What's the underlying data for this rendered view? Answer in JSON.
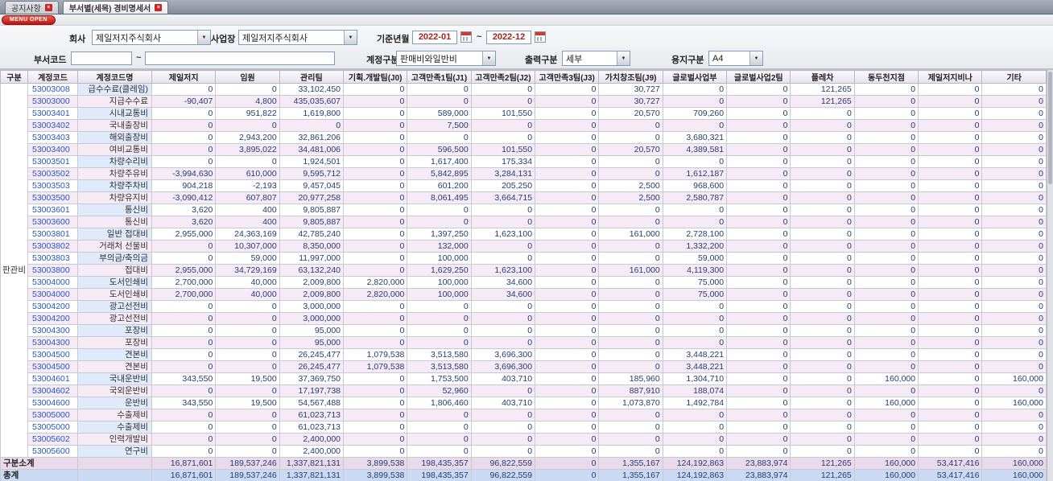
{
  "tabs": [
    {
      "label": "공지사항"
    },
    {
      "label": "부서별(세목) 경비명세서"
    }
  ],
  "menu_open_label": "MENU OPEN",
  "filters": {
    "company_label": "회사",
    "company_value": "제일저지주식회사",
    "workplace_label": "사업장",
    "workplace_value": "제일저지주식회사",
    "period_label": "기준년월",
    "period_from": "2022-01",
    "period_to": "2022-12",
    "tilde": "~",
    "dept_code_label": "부서코드",
    "dept_code_from": "",
    "dept_code_to": "",
    "account_type_label": "계정구분",
    "account_type_value": "판매비와일반비",
    "output_type_label": "출력구분",
    "output_type_value": "세부",
    "paper_type_label": "용지구분",
    "paper_type_value": "A4"
  },
  "table": {
    "headers": [
      "구분",
      "계정코드",
      "계정코드명",
      "제일저지",
      "임원",
      "관리팀",
      "기획.개발팀(J0)",
      "고객만족1팀(J1)",
      "고객만족2팀(J2)",
      "고객만족3팀(J3)",
      "가치창조팀(J9)",
      "글로벌사업부",
      "글로벌사업2팀",
      "플레차",
      "동두천지점",
      "제일저지비나",
      "기타"
    ],
    "group_label": "판관비",
    "rows": [
      {
        "code": "53003008",
        "name": "급수수료(클레임)",
        "values": [
          "0",
          "0",
          "33,102,450",
          "0",
          "0",
          "0",
          "0",
          "30,727",
          "0",
          "0",
          "121,265",
          "0",
          "0",
          "0"
        ]
      },
      {
        "code": "53003000",
        "name": "지급수수료",
        "values": [
          "-90,407",
          "4,800",
          "435,035,607",
          "0",
          "0",
          "0",
          "0",
          "30,727",
          "0",
          "0",
          "121,265",
          "0",
          "0",
          "0"
        ]
      },
      {
        "code": "53003401",
        "name": "시내교통비",
        "values": [
          "0",
          "951,822",
          "1,619,800",
          "0",
          "589,000",
          "101,550",
          "0",
          "20,570",
          "709,260",
          "0",
          "0",
          "0",
          "0",
          "0"
        ]
      },
      {
        "code": "53003402",
        "name": "국내출장비",
        "values": [
          "0",
          "0",
          "0",
          "0",
          "7,500",
          "0",
          "0",
          "0",
          "0",
          "0",
          "0",
          "0",
          "0",
          "0"
        ]
      },
      {
        "code": "53003403",
        "name": "해외출장비",
        "values": [
          "0",
          "2,943,200",
          "32,861,206",
          "0",
          "0",
          "0",
          "0",
          "0",
          "3,680,321",
          "0",
          "0",
          "0",
          "0",
          "0"
        ]
      },
      {
        "code": "53003400",
        "name": "여비교통비",
        "values": [
          "0",
          "3,895,022",
          "34,481,006",
          "0",
          "596,500",
          "101,550",
          "0",
          "20,570",
          "4,389,581",
          "0",
          "0",
          "0",
          "0",
          "0"
        ]
      },
      {
        "code": "53003501",
        "name": "차량수리비",
        "values": [
          "0",
          "0",
          "1,924,501",
          "0",
          "1,617,400",
          "175,334",
          "0",
          "0",
          "0",
          "0",
          "0",
          "0",
          "0",
          "0"
        ]
      },
      {
        "code": "53003502",
        "name": "차량주유비",
        "values": [
          "-3,994,630",
          "610,000",
          "9,595,712",
          "0",
          "5,842,895",
          "3,284,131",
          "0",
          "0",
          "1,612,187",
          "0",
          "0",
          "0",
          "0",
          "0"
        ]
      },
      {
        "code": "53003503",
        "name": "차량주차비",
        "values": [
          "904,218",
          "-2,193",
          "9,457,045",
          "0",
          "601,200",
          "205,250",
          "0",
          "2,500",
          "968,600",
          "0",
          "0",
          "0",
          "0",
          "0"
        ]
      },
      {
        "code": "53003500",
        "name": "차량유지비",
        "values": [
          "-3,090,412",
          "607,807",
          "20,977,258",
          "0",
          "8,061,495",
          "3,664,715",
          "0",
          "2,500",
          "2,580,787",
          "0",
          "0",
          "0",
          "0",
          "0"
        ]
      },
      {
        "code": "53003601",
        "name": "통신비",
        "values": [
          "3,620",
          "400",
          "9,805,887",
          "0",
          "0",
          "0",
          "0",
          "0",
          "0",
          "0",
          "0",
          "0",
          "0",
          "0"
        ]
      },
      {
        "code": "53003600",
        "name": "통신비",
        "values": [
          "3,620",
          "400",
          "9,805,887",
          "0",
          "0",
          "0",
          "0",
          "0",
          "0",
          "0",
          "0",
          "0",
          "0",
          "0"
        ]
      },
      {
        "code": "53003801",
        "name": "일반 접대비",
        "values": [
          "2,955,000",
          "24,363,169",
          "42,785,240",
          "0",
          "1,397,250",
          "1,623,100",
          "0",
          "161,000",
          "2,728,100",
          "0",
          "0",
          "0",
          "0",
          "0"
        ]
      },
      {
        "code": "53003802",
        "name": "거래처 선물비",
        "values": [
          "0",
          "10,307,000",
          "8,350,000",
          "0",
          "132,000",
          "0",
          "0",
          "0",
          "1,332,200",
          "0",
          "0",
          "0",
          "0",
          "0"
        ]
      },
      {
        "code": "53003803",
        "name": "부의금/축의금",
        "values": [
          "0",
          "59,000",
          "11,997,000",
          "0",
          "100,000",
          "0",
          "0",
          "0",
          "59,000",
          "0",
          "0",
          "0",
          "0",
          "0"
        ]
      },
      {
        "code": "53003800",
        "name": "접대비",
        "values": [
          "2,955,000",
          "34,729,169",
          "63,132,240",
          "0",
          "1,629,250",
          "1,623,100",
          "0",
          "161,000",
          "4,119,300",
          "0",
          "0",
          "0",
          "0",
          "0"
        ]
      },
      {
        "code": "53004000",
        "name": "도서인쇄비",
        "values": [
          "2,700,000",
          "40,000",
          "2,009,800",
          "2,820,000",
          "100,000",
          "34,600",
          "0",
          "0",
          "75,000",
          "0",
          "0",
          "0",
          "0",
          "0"
        ]
      },
      {
        "code": "53004000",
        "name": "도서인쇄비",
        "values": [
          "2,700,000",
          "40,000",
          "2,009,800",
          "2,820,000",
          "100,000",
          "34,600",
          "0",
          "0",
          "75,000",
          "0",
          "0",
          "0",
          "0",
          "0"
        ]
      },
      {
        "code": "53004200",
        "name": "광고선전비",
        "values": [
          "0",
          "0",
          "3,000,000",
          "0",
          "0",
          "0",
          "0",
          "0",
          "0",
          "0",
          "0",
          "0",
          "0",
          "0"
        ]
      },
      {
        "code": "53004200",
        "name": "광고선전비",
        "values": [
          "0",
          "0",
          "3,000,000",
          "0",
          "0",
          "0",
          "0",
          "0",
          "0",
          "0",
          "0",
          "0",
          "0",
          "0"
        ]
      },
      {
        "code": "53004300",
        "name": "포장비",
        "values": [
          "0",
          "0",
          "95,000",
          "0",
          "0",
          "0",
          "0",
          "0",
          "0",
          "0",
          "0",
          "0",
          "0",
          "0"
        ]
      },
      {
        "code": "53004300",
        "name": "포장비",
        "values": [
          "0",
          "0",
          "95,000",
          "0",
          "0",
          "0",
          "0",
          "0",
          "0",
          "0",
          "0",
          "0",
          "0",
          "0"
        ]
      },
      {
        "code": "53004500",
        "name": "견본비",
        "values": [
          "0",
          "0",
          "26,245,477",
          "1,079,538",
          "3,513,580",
          "3,696,300",
          "0",
          "0",
          "3,448,221",
          "0",
          "0",
          "0",
          "0",
          "0"
        ]
      },
      {
        "code": "53004500",
        "name": "견본비",
        "values": [
          "0",
          "0",
          "26,245,477",
          "1,079,538",
          "3,513,580",
          "3,696,300",
          "0",
          "0",
          "3,448,221",
          "0",
          "0",
          "0",
          "0",
          "0"
        ]
      },
      {
        "code": "53004601",
        "name": "국내운반비",
        "values": [
          "343,550",
          "19,500",
          "37,369,750",
          "0",
          "1,753,500",
          "403,710",
          "0",
          "185,960",
          "1,304,710",
          "0",
          "0",
          "160,000",
          "0",
          "160,000"
        ]
      },
      {
        "code": "53004602",
        "name": "국외운반비",
        "values": [
          "0",
          "0",
          "17,197,738",
          "0",
          "52,960",
          "0",
          "0",
          "887,910",
          "188,074",
          "0",
          "0",
          "0",
          "0",
          "0"
        ]
      },
      {
        "code": "53004600",
        "name": "운반비",
        "values": [
          "343,550",
          "19,500",
          "54,567,488",
          "0",
          "1,806,460",
          "403,710",
          "0",
          "1,073,870",
          "1,492,784",
          "0",
          "0",
          "160,000",
          "0",
          "160,000"
        ]
      },
      {
        "code": "53005000",
        "name": "수출제비",
        "values": [
          "0",
          "0",
          "61,023,713",
          "0",
          "0",
          "0",
          "0",
          "0",
          "0",
          "0",
          "0",
          "0",
          "0",
          "0"
        ]
      },
      {
        "code": "53005000",
        "name": "수출제비",
        "values": [
          "0",
          "0",
          "61,023,713",
          "0",
          "0",
          "0",
          "0",
          "0",
          "0",
          "0",
          "0",
          "0",
          "0",
          "0"
        ]
      },
      {
        "code": "53005602",
        "name": "인력개발비",
        "values": [
          "0",
          "0",
          "2,400,000",
          "0",
          "0",
          "0",
          "0",
          "0",
          "0",
          "0",
          "0",
          "0",
          "0",
          "0"
        ]
      },
      {
        "code": "53005600",
        "name": "연구비",
        "values": [
          "0",
          "0",
          "2,400,000",
          "0",
          "0",
          "0",
          "0",
          "0",
          "0",
          "0",
          "0",
          "0",
          "0",
          "0"
        ]
      }
    ],
    "subtotal": {
      "label": "구분소계",
      "values": [
        "16,871,601",
        "189,537,246",
        "1,337,821,131",
        "3,899,538",
        "198,435,357",
        "96,822,559",
        "0",
        "1,355,167",
        "124,192,863",
        "23,883,974",
        "121,265",
        "160,000",
        "53,417,416",
        "160,000"
      ]
    },
    "total": {
      "label": "총계",
      "values": [
        "16,871,601",
        "189,537,246",
        "1,337,821,131",
        "3,899,538",
        "198,435,357",
        "96,822,559",
        "0",
        "1,355,167",
        "124,192,863",
        "23,883,974",
        "121,265",
        "160,000",
        "53,417,416",
        "160,000"
      ]
    }
  }
}
